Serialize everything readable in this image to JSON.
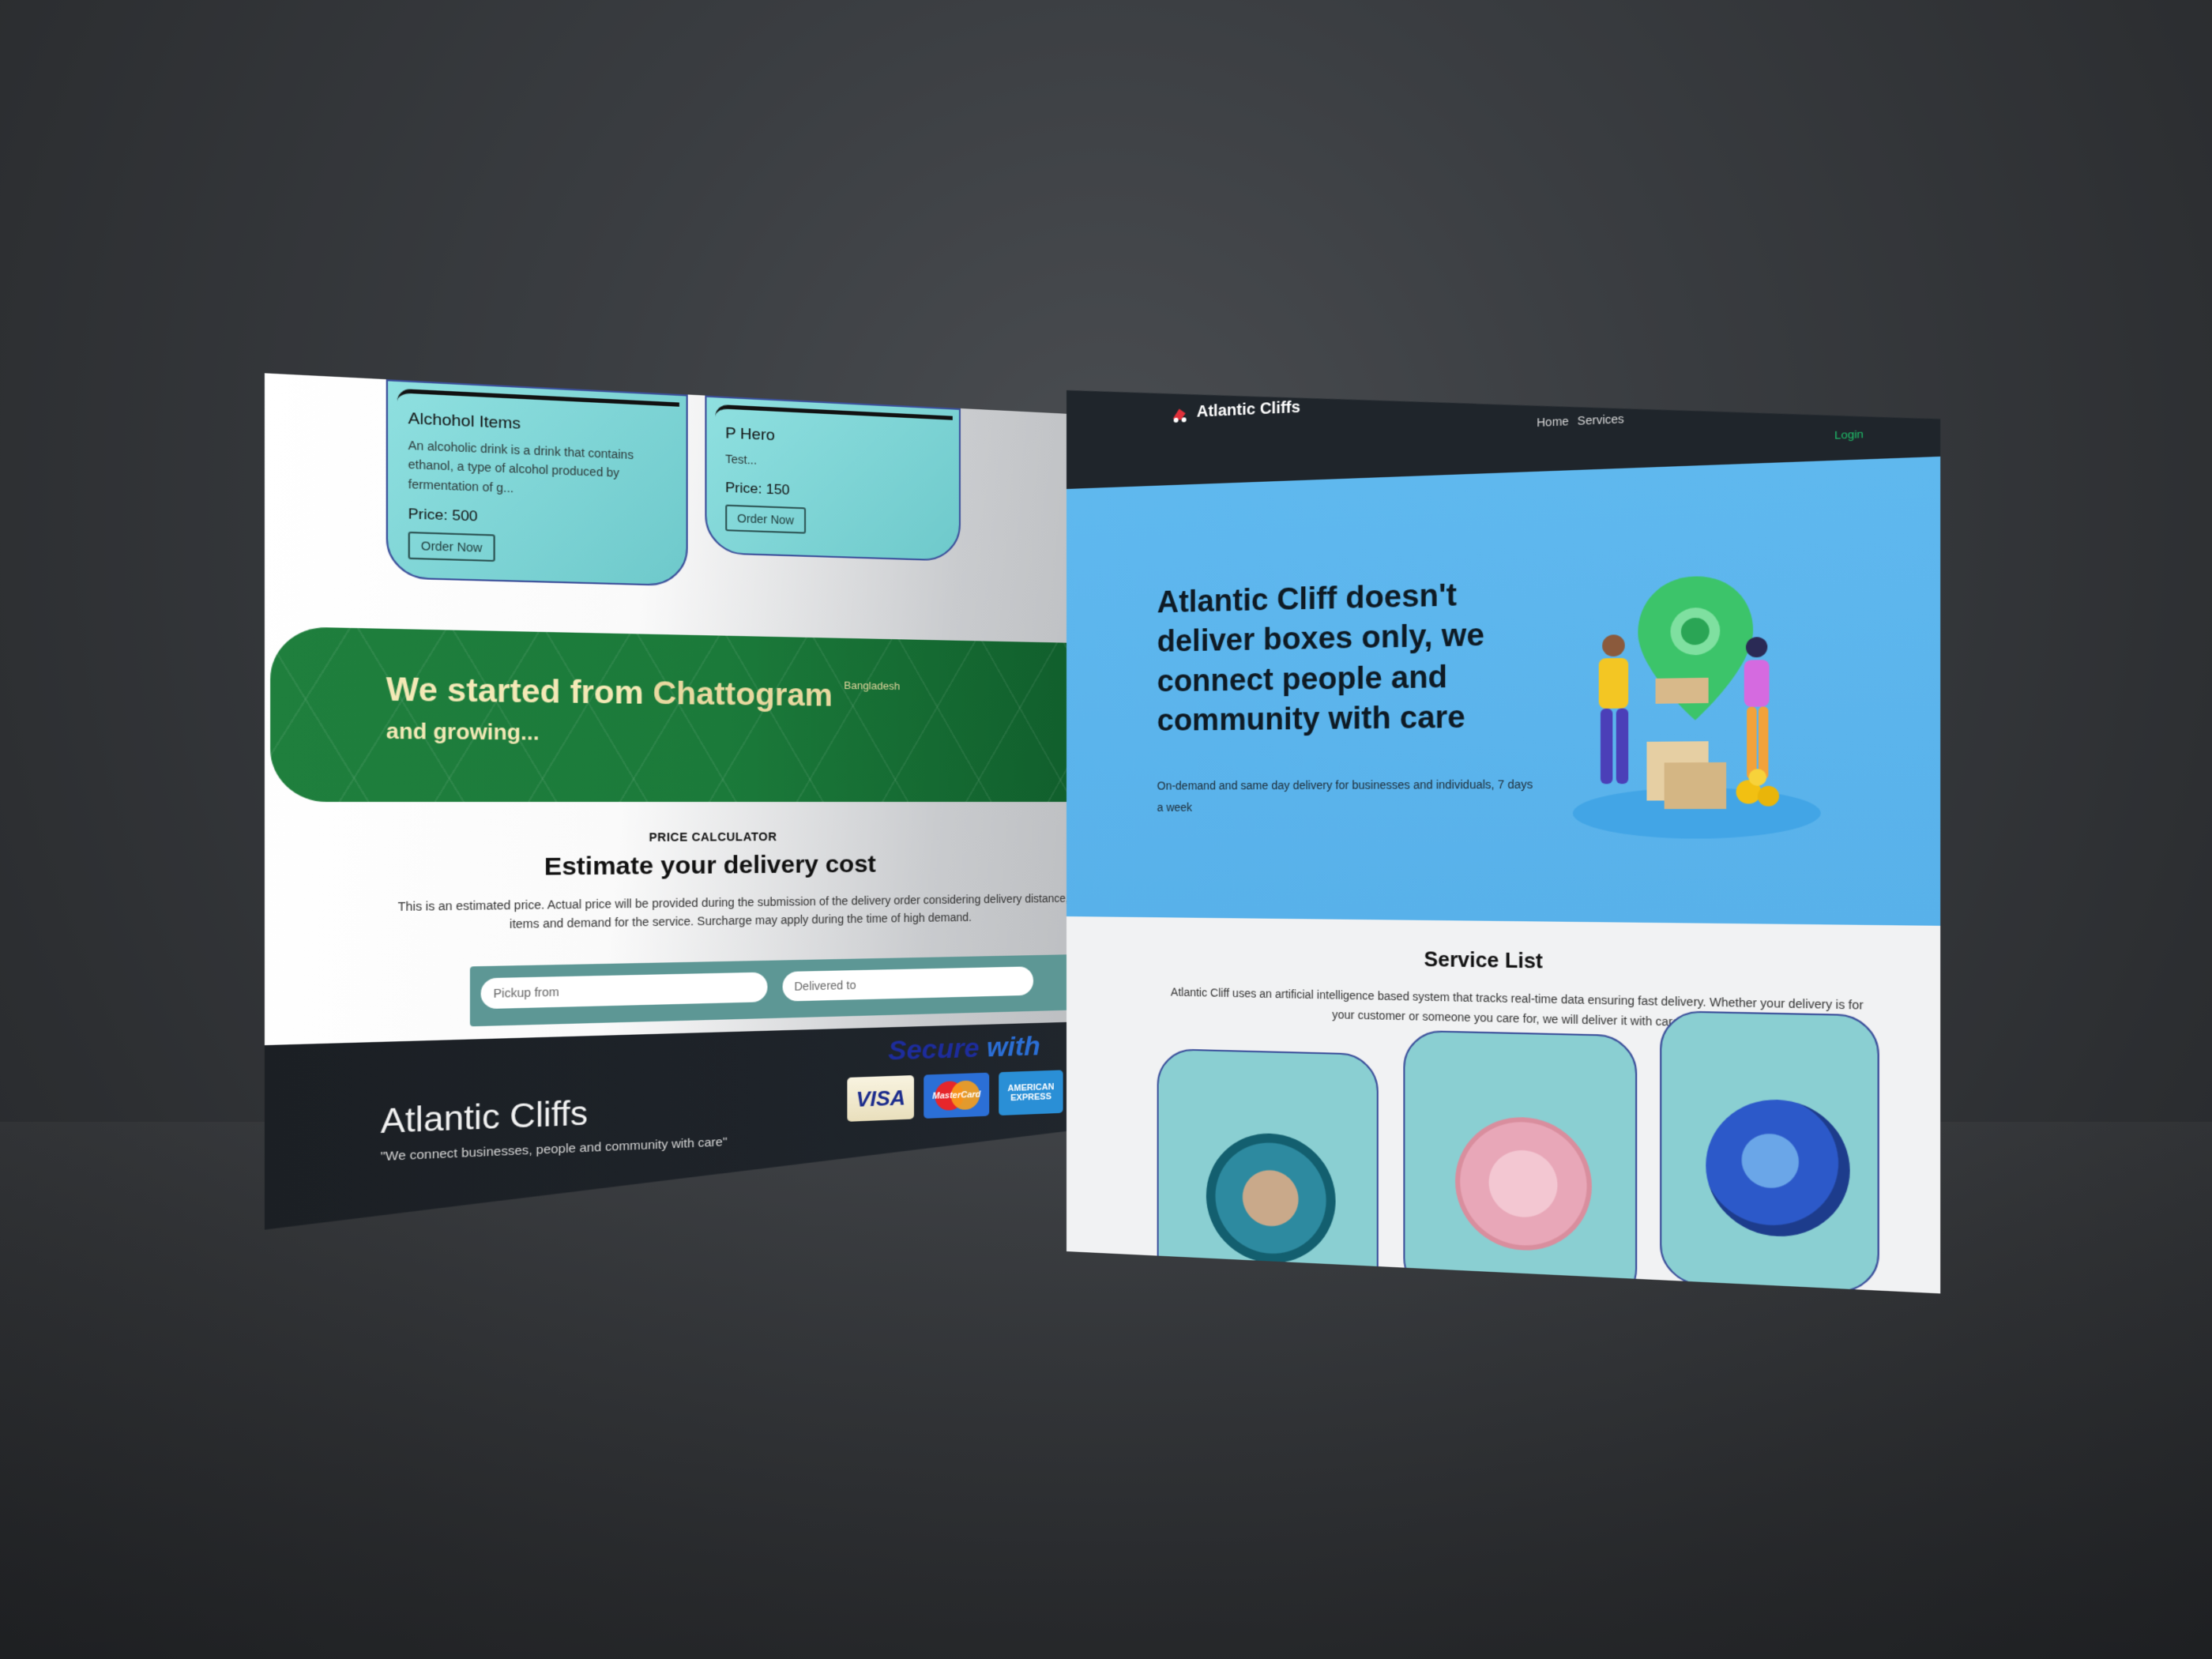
{
  "left_page": {
    "cards": [
      {
        "title": "Alchohol Items",
        "description": "An alcoholic drink is a drink that contains ethanol, a type of alcohol produced by fermentation of g...",
        "price": "Price: 500",
        "button": "Order Now"
      },
      {
        "title": "P Hero",
        "description": "Test...",
        "price": "Price: 150",
        "button": "Order Now"
      }
    ],
    "banner": {
      "title_prefix": "We started from",
      "title_city": "Chattogram",
      "country": "Bangladesh",
      "subtitle": "and growing..."
    },
    "calculator": {
      "kicker": "PRICE CALCULATOR",
      "title": "Estimate your delivery cost",
      "description": "This is an estimated price. Actual price will be provided during the submission of the delivery order considering delivery distance, items and demand for the service. Surcharge may apply during the time of high demand.",
      "pickup_placeholder": "Pickup from",
      "delivered_placeholder": "Delivered to"
    },
    "footer": {
      "brand": "Atlantic Cliffs",
      "tagline": "\"We connect businesses, people and community with care\"",
      "secure_1": "Secure",
      "secure_2": "with",
      "cards": {
        "visa": "VISA",
        "mastercard": "MasterCard",
        "amex": "AMERICAN EXPRESS"
      }
    }
  },
  "right_page": {
    "nav": {
      "brand": "Atlantic Cliffs",
      "links": [
        "Home",
        "Services"
      ],
      "login": "Login"
    },
    "hero": {
      "title": "Atlantic Cliff doesn't deliver boxes only, we connect people and community with care",
      "subtitle": "On-demand and same day delivery for businesses and individuals, 7 days a week"
    },
    "services": {
      "title": "Service List",
      "description": "Atlantic Cliff uses an artificial intelligence based system that tracks real-time data ensuring fast delivery. Whether your delivery is for your customer or someone you care for, we will deliver it with care."
    }
  },
  "colors": {
    "background": "#2c2e31",
    "card_teal": "#8fe0e0",
    "banner_green": "#1f7f3d",
    "hero_blue": "#60b9ef",
    "nav_dark": "#1f252b",
    "login_green": "#1fbf6a"
  }
}
